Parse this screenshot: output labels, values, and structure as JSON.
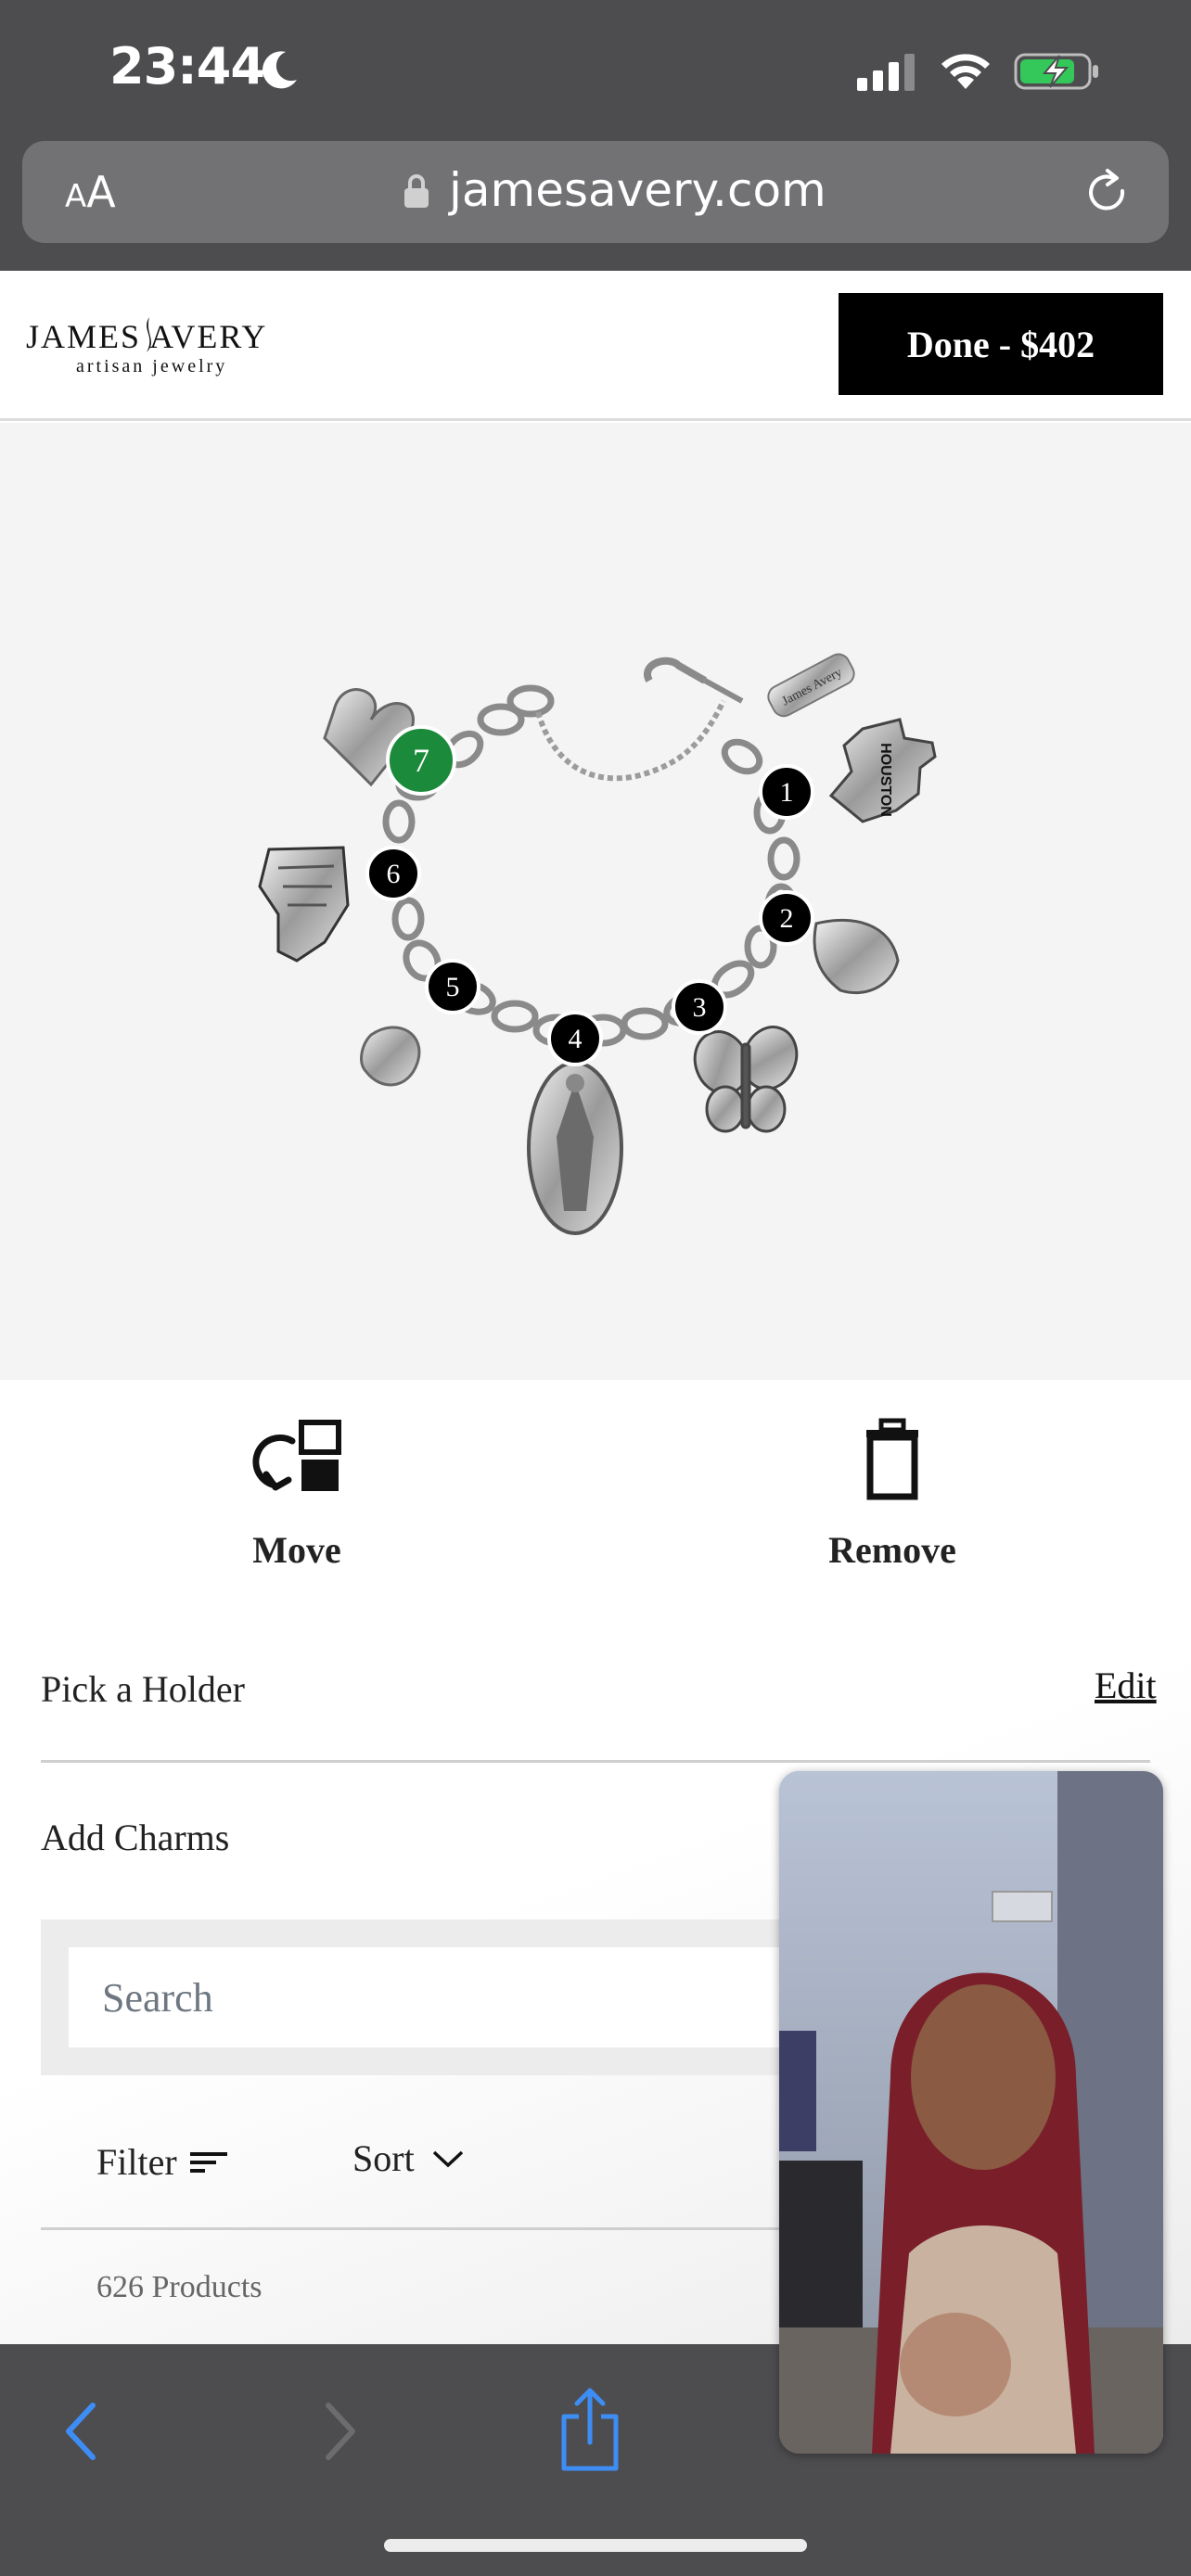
{
  "status_bar": {
    "time": "23:44"
  },
  "address_bar": {
    "aa_small": "A",
    "aa_large": "A",
    "url": "jamesavery.com"
  },
  "header": {
    "logo_main": "JAMES AVERY",
    "logo_sub": "artisan jewelry",
    "done_button": "Done - $402"
  },
  "bracelet": {
    "charm_markers": [
      "1",
      "2",
      "3",
      "4",
      "5",
      "6",
      "7"
    ],
    "selected_marker": "7",
    "tag_text": "James Avery",
    "state_charm_text": "HOUSTON",
    "colors": {
      "marker": "#000000",
      "selected_marker": "#1b8a3a",
      "stage": "#f4f4f4"
    }
  },
  "actions": {
    "move_label": "Move",
    "remove_label": "Remove"
  },
  "panel": {
    "pick_holder": "Pick a Holder",
    "edit": "Edit",
    "add_charms": "Add Charms",
    "search_placeholder": "Search",
    "filter": "Filter",
    "sort": "Sort",
    "product_count": "626 Products"
  },
  "icons": [
    "moon-icon",
    "signal-icon",
    "wifi-icon",
    "battery-icon",
    "lock-icon",
    "reload-icon",
    "move-icon",
    "trash-icon",
    "filter-lines-icon",
    "chevron-down-icon",
    "back-icon",
    "forward-icon",
    "share-icon"
  ]
}
